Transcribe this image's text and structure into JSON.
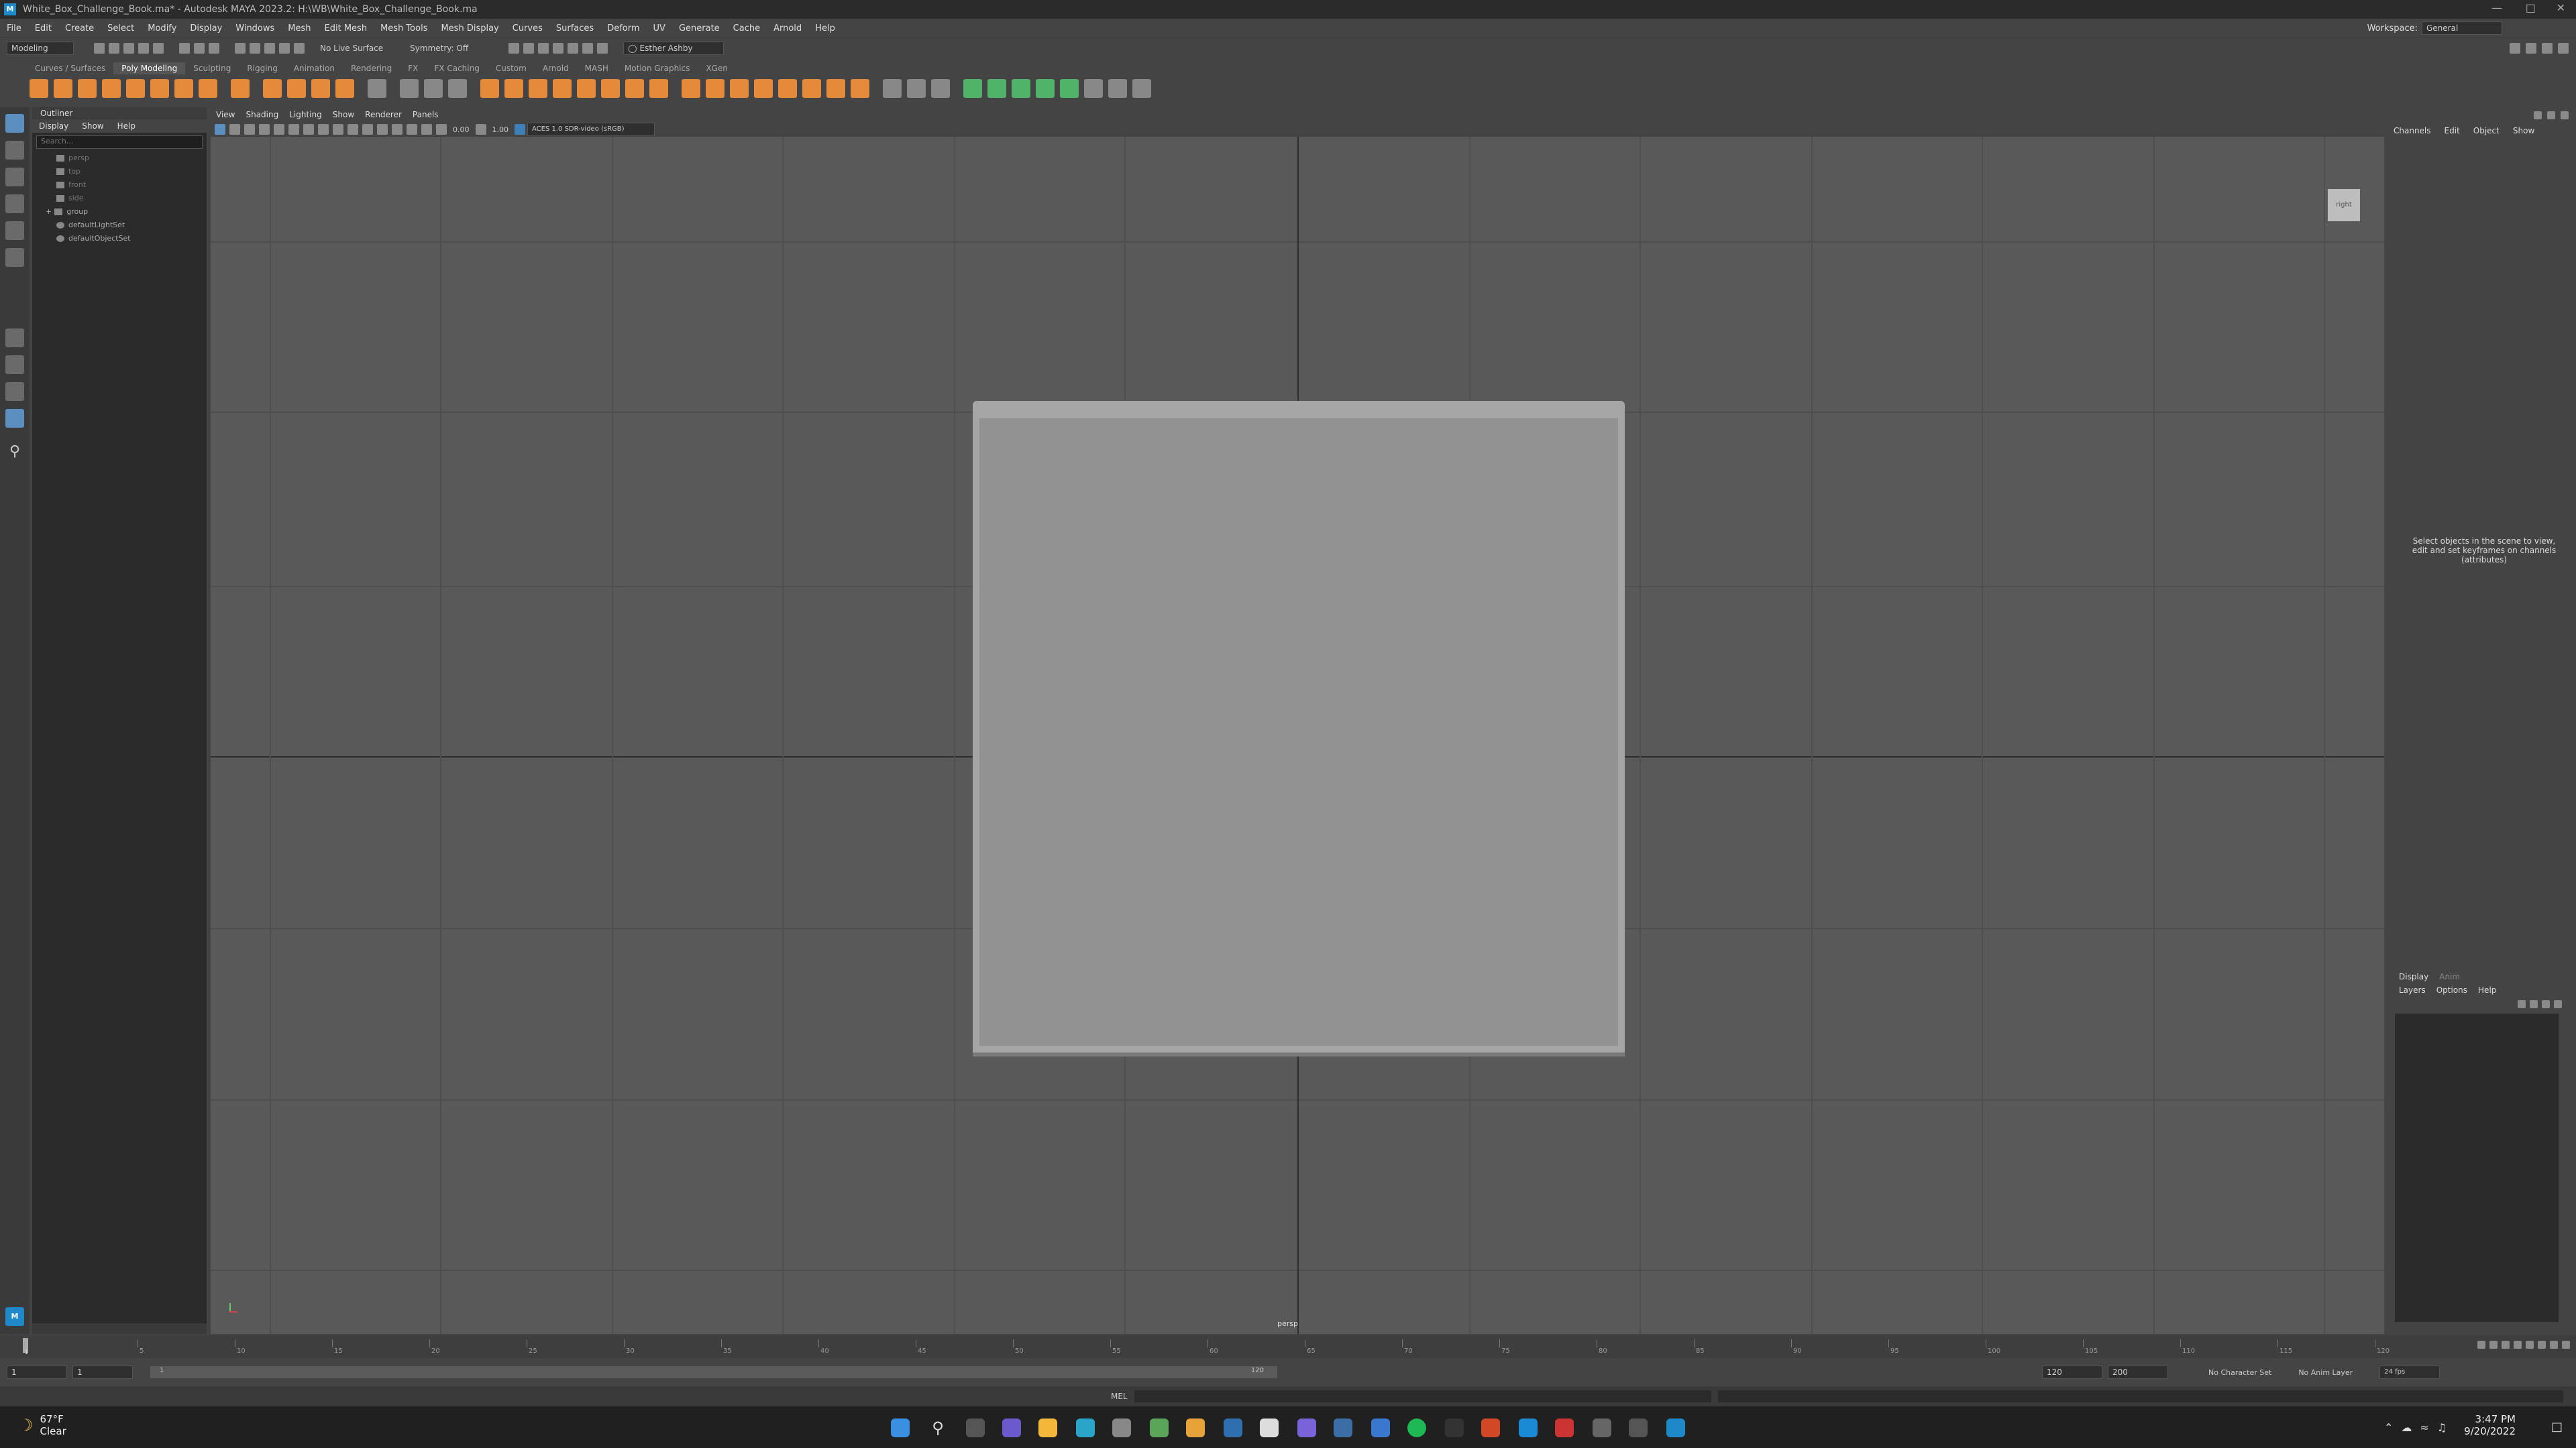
{
  "window": {
    "title": "White_Box_Challenge_Book.ma* - Autodesk MAYA 2023.2: H:\\WB\\White_Box_Challenge_Book.ma",
    "app_icon": "M"
  },
  "menubar": [
    "File",
    "Edit",
    "Create",
    "Select",
    "Modify",
    "Display",
    "Windows",
    "Mesh",
    "Edit Mesh",
    "Mesh Tools",
    "Mesh Display",
    "Curves",
    "Surfaces",
    "Deform",
    "UV",
    "Generate",
    "Cache",
    "Arnold",
    "Help"
  ],
  "workspace": {
    "label": "Workspace:",
    "value": "General"
  },
  "statusline": {
    "mode": "Modeling",
    "live_surface": "No Live Surface",
    "symmetry": "Symmetry: Off",
    "user": "Esther Ashby"
  },
  "shelf_tabs": [
    "Curves / Surfaces",
    "Poly Modeling",
    "Sculpting",
    "Rigging",
    "Animation",
    "Rendering",
    "FX",
    "FX Caching",
    "Custom",
    "Arnold",
    "MASH",
    "Motion Graphics",
    "XGen"
  ],
  "shelf_active": "Poly Modeling",
  "outliner": {
    "title": "Outliner",
    "menu": [
      "Display",
      "Show",
      "Help"
    ],
    "search_placeholder": "Search...",
    "items": [
      {
        "label": "persp",
        "dim": true
      },
      {
        "label": "top",
        "dim": true
      },
      {
        "label": "front",
        "dim": true
      },
      {
        "label": "side",
        "dim": true
      },
      {
        "label": "group",
        "dim": false
      },
      {
        "label": "defaultLightSet",
        "dim": false
      },
      {
        "label": "defaultObjectSet",
        "dim": false
      }
    ]
  },
  "viewport": {
    "menu": [
      "View",
      "Shading",
      "Lighting",
      "Show",
      "Renderer",
      "Panels"
    ],
    "exposure": "0.00",
    "gamma": "1.00",
    "colorspace": "ACES 1.0 SDR-video (sRGB)",
    "viewcube": "right",
    "camera": "persp"
  },
  "channelbox": {
    "menu": [
      "Channels",
      "Edit",
      "Object",
      "Show"
    ],
    "message": "Select objects in the scene to view, edit and set keyframes on channels (attributes)"
  },
  "layers": {
    "tabs": [
      "Display",
      "Anim"
    ],
    "menu": [
      "Layers",
      "Options",
      "Help"
    ]
  },
  "timeslider": {
    "current": "1",
    "ticks": [
      "5",
      "10",
      "15",
      "20",
      "25",
      "30",
      "35",
      "40",
      "45",
      "50",
      "55",
      "60",
      "65",
      "70",
      "75",
      "80",
      "85",
      "90",
      "95",
      "100",
      "105",
      "110",
      "115",
      "120"
    ]
  },
  "range": {
    "start": "1",
    "range_start": "1",
    "slider_start": "1",
    "slider_end": "120",
    "range_end": "120",
    "end": "200",
    "character_set": "No Character Set",
    "anim_layer": "No Anim Layer",
    "fps": "24 fps"
  },
  "cmdline": {
    "label": "MEL"
  },
  "taskbar": {
    "temp": "67°F",
    "condition": "Clear",
    "time": "3:47 PM",
    "date": "9/20/2022"
  }
}
